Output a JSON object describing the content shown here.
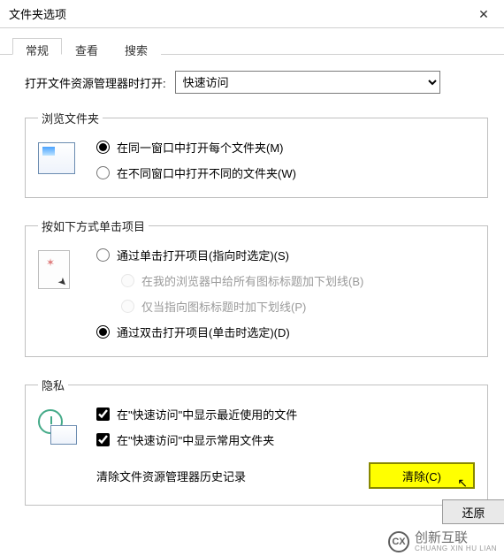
{
  "window": {
    "title": "文件夹选项"
  },
  "tabs": {
    "general": "常规",
    "view": "查看",
    "search": "搜索"
  },
  "open_with": {
    "label": "打开文件资源管理器时打开:",
    "selected": "快速访问"
  },
  "browse": {
    "legend": "浏览文件夹",
    "same_window": "在同一窗口中打开每个文件夹(M)",
    "new_window": "在不同窗口中打开不同的文件夹(W)"
  },
  "click_mode": {
    "legend": "按如下方式单击项目",
    "single": "通过单击打开项目(指向时选定)(S)",
    "underline_browser": "在我的浏览器中给所有图标标题加下划线(B)",
    "underline_point": "仅当指向图标标题时加下划线(P)",
    "double": "通过双击打开项目(单击时选定)(D)"
  },
  "privacy": {
    "legend": "隐私",
    "recent_files": "在\"快速访问\"中显示最近使用的文件",
    "freq_folders": "在\"快速访问\"中显示常用文件夹",
    "clear_label": "清除文件资源管理器历史记录",
    "clear_button": "清除(C)"
  },
  "footer": {
    "restore": "还原"
  },
  "watermark": {
    "brand": "创新互联",
    "sub": "CHUANG XIN HU LIAN"
  }
}
